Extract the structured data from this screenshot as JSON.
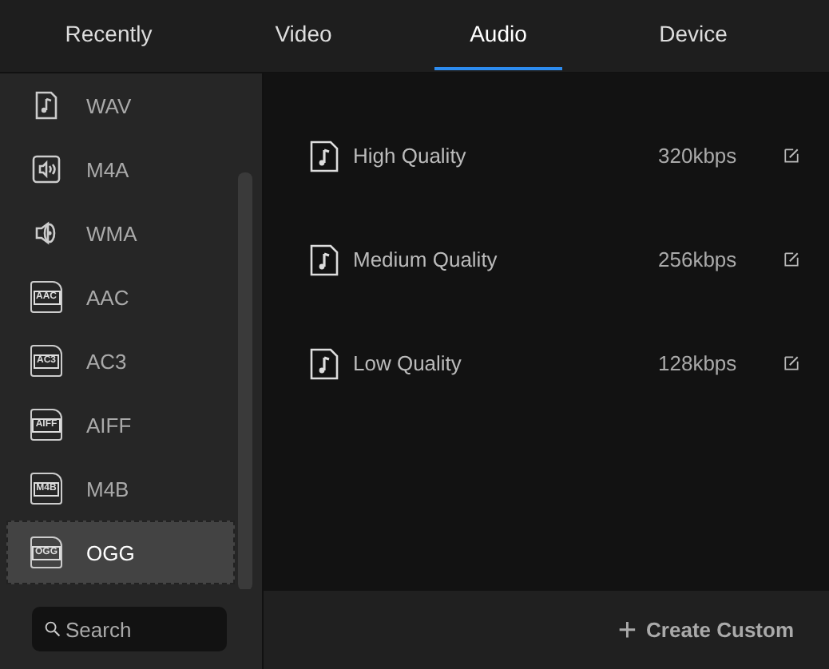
{
  "tabs": [
    {
      "label": "Recently",
      "selected": false
    },
    {
      "label": "Video",
      "selected": false
    },
    {
      "label": "Audio",
      "selected": true
    },
    {
      "label": "Device",
      "selected": false
    }
  ],
  "sidebar": {
    "items": [
      {
        "label": "WAV",
        "kind": "note-file",
        "selected": false
      },
      {
        "label": "M4A",
        "kind": "speaker-box",
        "selected": false
      },
      {
        "label": "WMA",
        "kind": "speaker",
        "selected": false
      },
      {
        "label": "AAC",
        "kind": "file-badge",
        "badge": "AAC",
        "selected": false
      },
      {
        "label": "AC3",
        "kind": "file-badge",
        "badge": "AC3",
        "selected": false
      },
      {
        "label": "AIFF",
        "kind": "file-badge",
        "badge": "AIFF",
        "selected": false
      },
      {
        "label": "M4B",
        "kind": "file-badge",
        "badge": "M4B",
        "selected": false
      },
      {
        "label": "OGG",
        "kind": "file-badge",
        "badge": "OGG",
        "selected": true
      }
    ],
    "search": {
      "placeholder": "Search"
    }
  },
  "presets": [
    {
      "name": "High Quality",
      "bitrate": "320kbps"
    },
    {
      "name": "Medium Quality",
      "bitrate": "256kbps"
    },
    {
      "name": "Low Quality",
      "bitrate": "128kbps"
    }
  ],
  "create_button": {
    "icon": "+",
    "label": "Create Custom"
  }
}
